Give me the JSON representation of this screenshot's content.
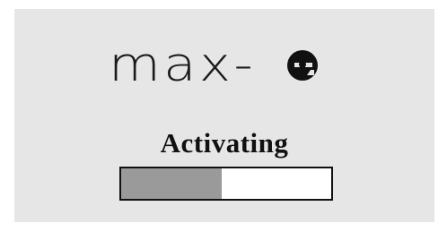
{
  "logo": {
    "text": "max-",
    "mark_icon": "e-logo-icon"
  },
  "status": {
    "label": "Activating"
  },
  "progress": {
    "fraction": 0.48,
    "fill_color": "#9a9a9a",
    "track_color": "#ffffff"
  },
  "colors": {
    "screen_background": "#e6e6e6",
    "foreground": "#111111"
  }
}
